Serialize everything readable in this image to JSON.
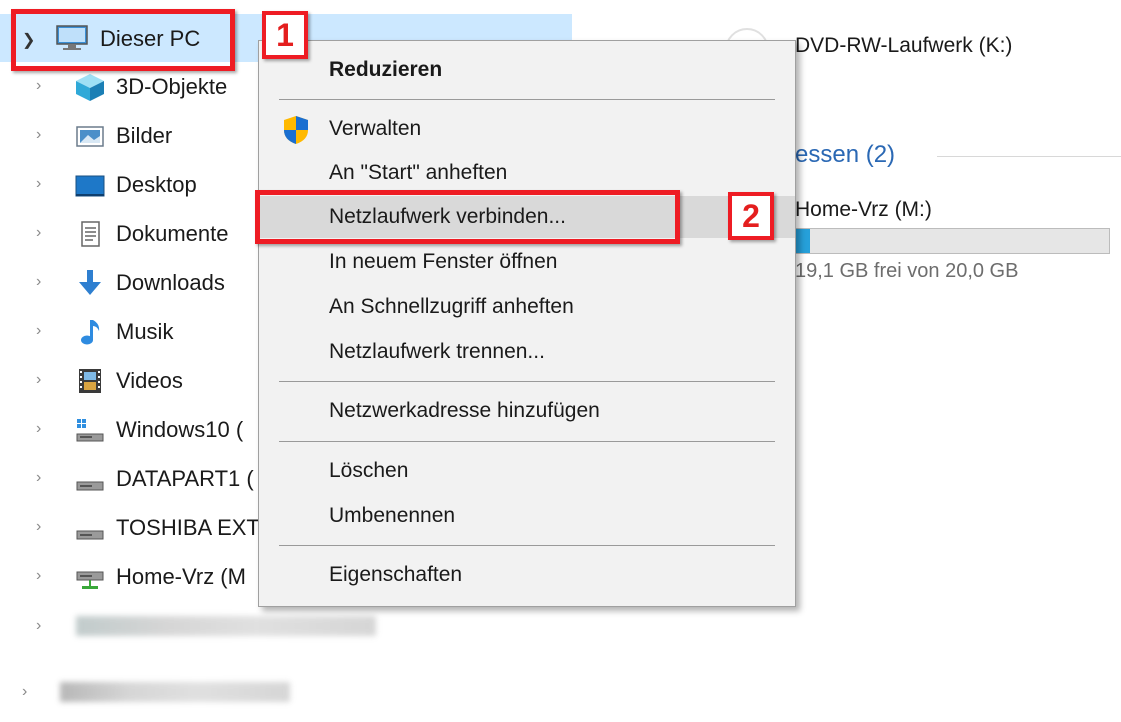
{
  "nav_tree": {
    "root": {
      "label": "Dieser PC",
      "icon": "computer-icon"
    },
    "items": [
      {
        "label": "3D-Objekte",
        "icon": "cube-3d-icon"
      },
      {
        "label": "Bilder",
        "icon": "pictures-icon"
      },
      {
        "label": "Desktop",
        "icon": "desktop-icon"
      },
      {
        "label": "Dokumente",
        "icon": "documents-icon"
      },
      {
        "label": "Downloads",
        "icon": "download-arrow-icon"
      },
      {
        "label": "Musik",
        "icon": "music-note-icon"
      },
      {
        "label": "Videos",
        "icon": "film-icon"
      },
      {
        "label": "Windows10 (",
        "icon": "system-drive-icon"
      },
      {
        "label": "DATAPART1 (",
        "icon": "drive-icon"
      },
      {
        "label": "TOSHIBA EXT",
        "icon": "drive-icon"
      },
      {
        "label": "Home-Vrz (M",
        "icon": "network-drive-icon"
      }
    ]
  },
  "right_pane": {
    "dvd_label": "DVD-RW-Laufwerk (K:)",
    "section_title": "essen (2)",
    "network_drive": {
      "name": "Home-Vrz (M:)",
      "free_text": "19,1 GB frei von 20,0 GB",
      "used_fraction": 0.045
    }
  },
  "context_menu": {
    "collapse": "Reduzieren",
    "manage": "Verwalten",
    "pin_start": "An \"Start\" anheften",
    "map_drive": "Netzlaufwerk verbinden...",
    "open_new_window": "In neuem Fenster öffnen",
    "pin_quick": "An Schnellzugriff anheften",
    "disconnect_drive": "Netzlaufwerk trennen...",
    "add_network_location": "Netzwerkadresse hinzufügen",
    "delete": "Löschen",
    "rename": "Umbenennen",
    "properties": "Eigenschaften"
  },
  "annotations": {
    "step1": "1",
    "step2": "2"
  },
  "colors": {
    "selection": "#cce8ff",
    "accent": "#26a0da",
    "annotation_red": "#ee1c24",
    "section_blue": "#2a68b4"
  }
}
